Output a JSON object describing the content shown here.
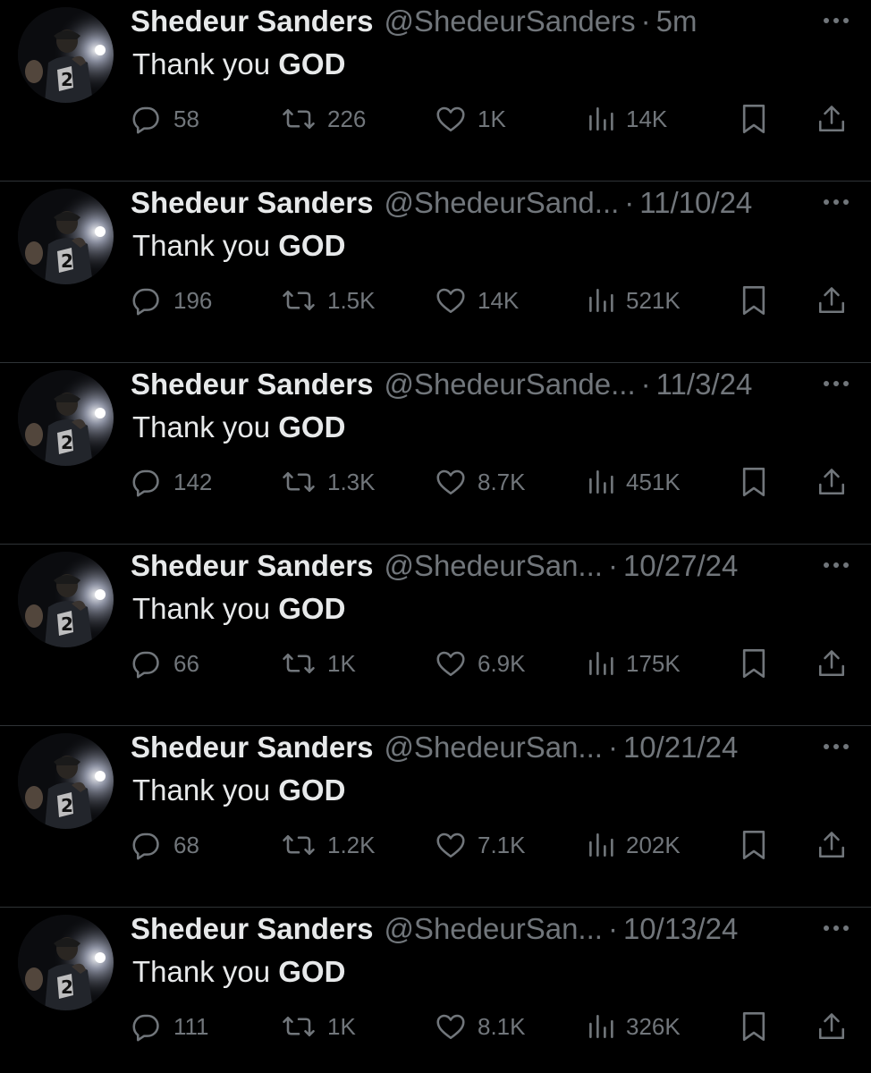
{
  "colors": {
    "background": "#000000",
    "primary_text": "#e7e9ea",
    "secondary_text": "#71767b",
    "divider": "#2f3336"
  },
  "icons": [
    "avatar",
    "more-icon",
    "reply-icon",
    "retweet-icon",
    "like-icon",
    "views-icon",
    "bookmark-icon",
    "share-icon"
  ],
  "tweets": [
    {
      "name": "Shedeur Sanders",
      "handle": "@ShedeurSanders",
      "separator": "·",
      "time": "5m",
      "text_plain": "Thank you ",
      "text_bold": "GOD",
      "replies": "58",
      "reposts": "226",
      "likes": "1K",
      "views": "14K"
    },
    {
      "name": "Shedeur Sanders",
      "handle": "@ShedeurSand...",
      "separator": "·",
      "time": "11/10/24",
      "text_plain": "Thank you ",
      "text_bold": "GOD",
      "replies": "196",
      "reposts": "1.5K",
      "likes": "14K",
      "views": "521K"
    },
    {
      "name": "Shedeur Sanders",
      "handle": "@ShedeurSande...",
      "separator": "·",
      "time": "11/3/24",
      "text_plain": "Thank you ",
      "text_bold": "GOD",
      "replies": "142",
      "reposts": "1.3K",
      "likes": "8.7K",
      "views": "451K"
    },
    {
      "name": "Shedeur Sanders",
      "handle": "@ShedeurSan...",
      "separator": "·",
      "time": "10/27/24",
      "text_plain": "Thank you ",
      "text_bold": "GOD",
      "replies": "66",
      "reposts": "1K",
      "likes": "6.9K",
      "views": "175K"
    },
    {
      "name": "Shedeur Sanders",
      "handle": "@ShedeurSan...",
      "separator": "·",
      "time": "10/21/24",
      "text_plain": "Thank you ",
      "text_bold": "GOD",
      "replies": "68",
      "reposts": "1.2K",
      "likes": "7.1K",
      "views": "202K"
    },
    {
      "name": "Shedeur Sanders",
      "handle": "@ShedeurSan...",
      "separator": "·",
      "time": "10/13/24",
      "text_plain": "Thank you ",
      "text_bold": "GOD",
      "replies": "111",
      "reposts": "1K",
      "likes": "8.1K",
      "views": "326K"
    }
  ]
}
